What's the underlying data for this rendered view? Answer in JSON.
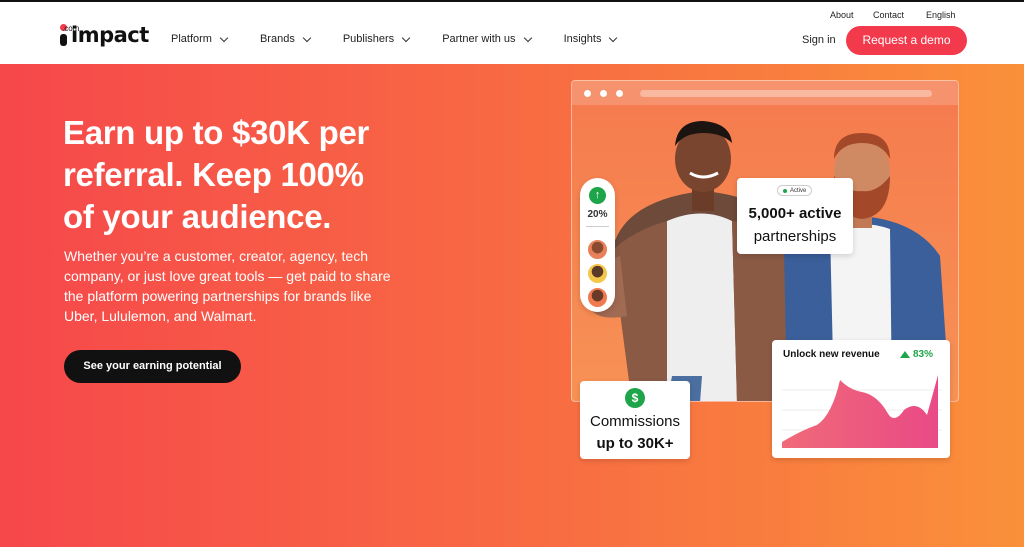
{
  "header": {
    "logo_word": "impact",
    "logo_sub": ".com",
    "nav": [
      {
        "label": "Platform"
      },
      {
        "label": "Brands"
      },
      {
        "label": "Publishers"
      },
      {
        "label": "Partner with us"
      },
      {
        "label": "Insights"
      }
    ],
    "utility": {
      "about": "About",
      "contact": "Contact",
      "language": "English"
    },
    "sign_in": "Sign in",
    "demo_button": "Request a demo"
  },
  "hero": {
    "headline": "Earn up to $30K per referral. Keep 100% of your audience.",
    "subtext": "Whether you’re a customer, creator, agency, tech company, or just love great tools — get paid to share the platform powering partnerships for brands like Uber, Lululemon, and Walmart.",
    "cta": "See your earning potential"
  },
  "visual": {
    "growth_pct": "20%",
    "active_badge": "Active",
    "partnerships_line1": "5,000+ active",
    "partnerships_line2": "partnerships",
    "revenue_title": "Unlock new revenue",
    "revenue_pct": "83%",
    "commission_line1": "Commissions",
    "commission_line2": "up to 30K+",
    "dollar_symbol": "$",
    "up_arrow": "↑"
  },
  "colors": {
    "brand_red": "#f23a4c",
    "hero_start": "#f6474b",
    "hero_end": "#fa903a",
    "growth_green": "#1ea54a"
  }
}
